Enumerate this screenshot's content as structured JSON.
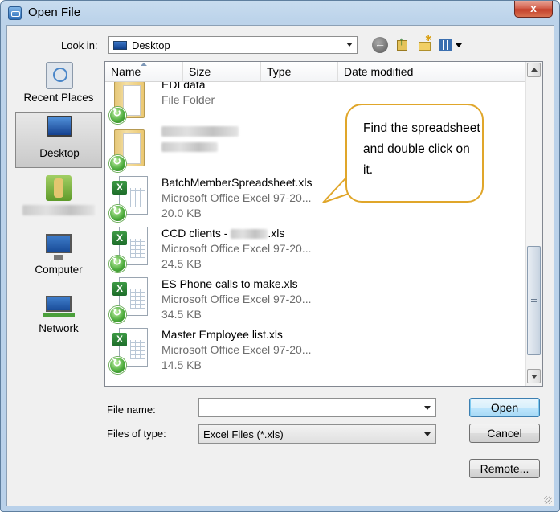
{
  "window": {
    "title": "Open File",
    "close_label": "x"
  },
  "toolbar": {
    "look_in_label": "Look in:",
    "look_in_value": "Desktop",
    "icons": [
      "back-icon",
      "up-folder-icon",
      "new-folder-icon",
      "views-menu-icon"
    ]
  },
  "places": [
    {
      "label": "Recent Places",
      "icon": "recent-places-icon",
      "selected": false
    },
    {
      "label": "Desktop",
      "icon": "desktop-icon",
      "selected": true
    },
    {
      "label": "",
      "icon": "user-folder-icon",
      "selected": false,
      "redacted": true
    },
    {
      "label": "Computer",
      "icon": "computer-icon",
      "selected": false
    },
    {
      "label": "Network",
      "icon": "network-icon",
      "selected": false
    }
  ],
  "columns": [
    "Name",
    "Size",
    "Type",
    "Date modified"
  ],
  "files": [
    {
      "name": "EDI data",
      "type": "File Folder",
      "size": "",
      "kind": "folder"
    },
    {
      "name": "",
      "type": "",
      "size": "",
      "kind": "folder",
      "redacted": true
    },
    {
      "name": "BatchMemberSpreadsheet.xls",
      "type": "Microsoft Office Excel 97-20...",
      "size": "20.0 KB",
      "kind": "xls"
    },
    {
      "name": "CCD clients - ",
      "name_suffix": ".xls",
      "type": "Microsoft Office Excel 97-20...",
      "size": "24.5 KB",
      "kind": "xls",
      "partially_redacted": true
    },
    {
      "name": "ES Phone calls to make.xls",
      "type": "Microsoft Office Excel 97-20...",
      "size": "34.5 KB",
      "kind": "xls"
    },
    {
      "name": "Master Employee list.xls",
      "type": "Microsoft Office Excel 97-20...",
      "size": "14.5 KB",
      "kind": "xls"
    }
  ],
  "callout": {
    "text": "Find the spreadsheet and double click on it.",
    "border_color": "#e0a62a"
  },
  "footer": {
    "file_name_label": "File name:",
    "file_name_value": "",
    "files_of_type_label": "Files of type:",
    "files_of_type_value": "Excel Files (*.xls)"
  },
  "buttons": {
    "open": "Open",
    "cancel": "Cancel",
    "remote": "Remote..."
  },
  "colors": {
    "selection_accent": "#3c7fb1",
    "excel_green": "#1d6d2a"
  }
}
